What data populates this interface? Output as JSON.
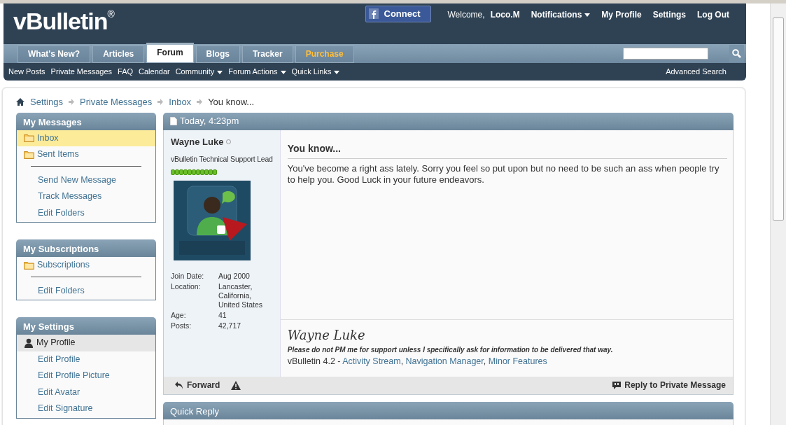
{
  "header": {
    "logo": "vBulletin",
    "logo_mark": "®",
    "connect": "Connect",
    "welcome": "Welcome,",
    "user": "Loco.M",
    "links": [
      {
        "label": "Notifications",
        "dropdown": true
      },
      {
        "label": "My Profile",
        "dropdown": false
      },
      {
        "label": "Settings",
        "dropdown": false
      },
      {
        "label": "Log Out",
        "dropdown": false
      }
    ]
  },
  "tabs": [
    {
      "label": "What's New?",
      "selected": false,
      "highlight": false
    },
    {
      "label": "Articles",
      "selected": false,
      "highlight": false
    },
    {
      "label": "Forum",
      "selected": true,
      "highlight": false
    },
    {
      "label": "Blogs",
      "selected": false,
      "highlight": false
    },
    {
      "label": "Tracker",
      "selected": false,
      "highlight": false
    },
    {
      "label": "Purchase",
      "selected": false,
      "highlight": true
    }
  ],
  "subnav": [
    {
      "label": "New Posts",
      "dropdown": false
    },
    {
      "label": "Private Messages",
      "dropdown": false
    },
    {
      "label": "FAQ",
      "dropdown": false
    },
    {
      "label": "Calendar",
      "dropdown": false
    },
    {
      "label": "Community",
      "dropdown": true
    },
    {
      "label": "Forum Actions",
      "dropdown": true
    },
    {
      "label": "Quick Links",
      "dropdown": true
    }
  ],
  "advanced_search": "Advanced Search",
  "breadcrumb": [
    "Settings",
    "Private Messages",
    "Inbox",
    "You know..."
  ],
  "sidebar": [
    {
      "title": "My Messages",
      "items": [
        {
          "kind": "folder",
          "label": "Inbox",
          "selected": true
        },
        {
          "kind": "folder",
          "label": "Sent Items",
          "selected": false
        },
        {
          "kind": "divider"
        },
        {
          "kind": "link",
          "label": "Send New Message",
          "selected": false
        },
        {
          "kind": "link",
          "label": "Track Messages",
          "selected": false
        },
        {
          "kind": "link",
          "label": "Edit Folders",
          "selected": false
        }
      ]
    },
    {
      "title": "My Subscriptions",
      "items": [
        {
          "kind": "folder",
          "label": "Subscriptions",
          "selected": false
        },
        {
          "kind": "divider"
        },
        {
          "kind": "link",
          "label": "Edit Folders",
          "selected": false
        }
      ]
    },
    {
      "title": "My Settings",
      "items": [
        {
          "kind": "profile",
          "label": "My Profile",
          "selected": true
        },
        {
          "kind": "link",
          "label": "Edit Profile",
          "selected": false
        },
        {
          "kind": "link",
          "label": "Edit Profile Picture",
          "selected": false
        },
        {
          "kind": "link",
          "label": "Edit Avatar",
          "selected": false
        },
        {
          "kind": "link",
          "label": "Edit Signature",
          "selected": false
        }
      ]
    }
  ],
  "post": {
    "date": "Today, 4:23pm",
    "author": "Wayne Luke",
    "online": false,
    "usertitle": "vBulletin Technical Support Lead",
    "details": [
      {
        "label": "Join Date:",
        "value": "Aug 2000"
      },
      {
        "label": "Location:",
        "value": "Lancaster, California, United States"
      },
      {
        "label": "Age:",
        "value": "41"
      },
      {
        "label": "Posts:",
        "value": "42,717"
      }
    ],
    "title": "You know...",
    "message": "You've become a right ass lately. Sorry you feel so put upon but no need to be such an ass when people try to help you. Good Luck in your future endeavors.",
    "signature": {
      "name": "Wayne Luke",
      "note": "Please do not PM me for support unless I specifically ask for information to be delivered that way.",
      "prefix": "vBulletin 4.2 - ",
      "separator": ",",
      "links": [
        "Activity Stream",
        "Navigation Manager",
        "Minor Features"
      ]
    },
    "actions": {
      "forward": "Forward",
      "reply": "Reply to Private Message"
    }
  },
  "quick_reply": "Quick Reply"
}
